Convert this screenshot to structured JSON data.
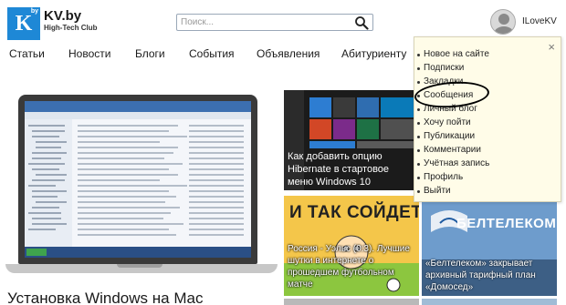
{
  "header": {
    "logo_letter": "K",
    "logo_suffix": "by",
    "brand_name": "KV.by",
    "brand_subtitle": "High-Tech Club",
    "search_placeholder": "Поиск...",
    "username": "ILoveKV"
  },
  "nav": {
    "items": [
      "Статьи",
      "Новости",
      "Блоги",
      "События",
      "Объявления",
      "Абитуриенту"
    ]
  },
  "dropdown": {
    "close": "×",
    "items": [
      "Новое на сайте",
      "Подписки",
      "Закладки",
      "Сообщения",
      "Личный блог",
      "Хочу пойти",
      "Публикации",
      "Комментарии",
      "Учётная запись",
      "Профиль",
      "Выйти"
    ],
    "highlighted": "Сообщения"
  },
  "articles": {
    "main_title": "Установка Windows на Mac",
    "windows_caption": "Как добавить опцию Hibernate в стартовое меню Windows 10",
    "cartoon_headline": "И ТАК СОЙДЕТ...",
    "cartoon_caption": "Россия - Уэльс (0:3). Лучшие шутки в интернете о прошедшем футбольном матче",
    "beltel_brand": "БЕЛТЕЛЕКОМ",
    "beltel_caption": "«Белтелеком» закрывает архивный тарифный план «Домосед»"
  },
  "colors": {
    "logo_blue": "#1e88d6",
    "dropdown_bg": "#fffce8"
  }
}
